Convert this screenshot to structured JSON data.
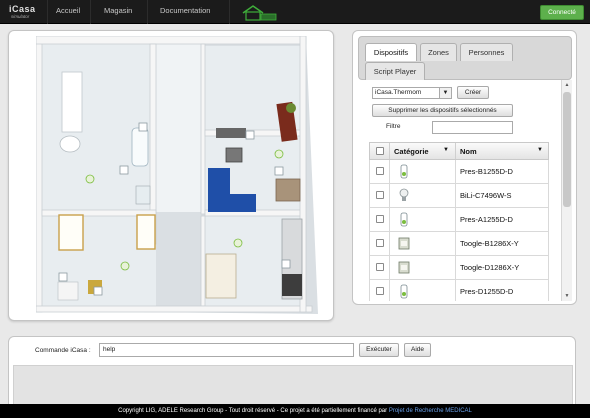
{
  "nav": {
    "brand": "iCasa",
    "brand_sub": "simulator",
    "links": [
      "Accueil",
      "Magasin",
      "Documentation"
    ],
    "connect_label": "Connecté"
  },
  "users": [
    {
      "icon": "male-user-icon"
    },
    {
      "icon": "female-user-icon"
    }
  ],
  "device_panel": {
    "tabs": [
      "Dispositifs",
      "Zones",
      "Personnes",
      "Script Player"
    ],
    "active_tab": "Dispositifs",
    "device_type_value": "iCasa.Thermom",
    "create_label": "Créer",
    "delete_label": "Supprimer les dispositifs sélectionnés",
    "filter_label": "Filtre",
    "filter_value": "",
    "columns": [
      "Catégorie",
      "Nom"
    ],
    "devices": [
      {
        "icon": "thermometer-icon",
        "name": "Pres-B1255D-D"
      },
      {
        "icon": "light-bulb-icon",
        "name": "BiLi-C7496W-S"
      },
      {
        "icon": "thermometer-icon",
        "name": "Pres-A1255D-D"
      },
      {
        "icon": "toggle-switch-icon",
        "name": "Toogle-B1286X-Y"
      },
      {
        "icon": "toggle-switch-icon",
        "name": "Toogle-D1286X-Y"
      },
      {
        "icon": "thermometer-icon",
        "name": "Pres-D1255D-D"
      }
    ]
  },
  "console": {
    "label": "Commande iCasa :",
    "input_value": "help",
    "execute_label": "Exécuter",
    "help_label": "Aide"
  },
  "footer": {
    "text": "Copyright LIG, ADELE Research Group - Tout droit réservé - Ce projet a été partiellement financé par",
    "link": "Projet de Recherche MEDICAL"
  },
  "colors": {
    "topbar": "#1b1b1b",
    "connect_button": "#5db04c",
    "floor": "#e9eef1",
    "wall": "#f4f4f4",
    "sofa": "#1f4fa8"
  }
}
